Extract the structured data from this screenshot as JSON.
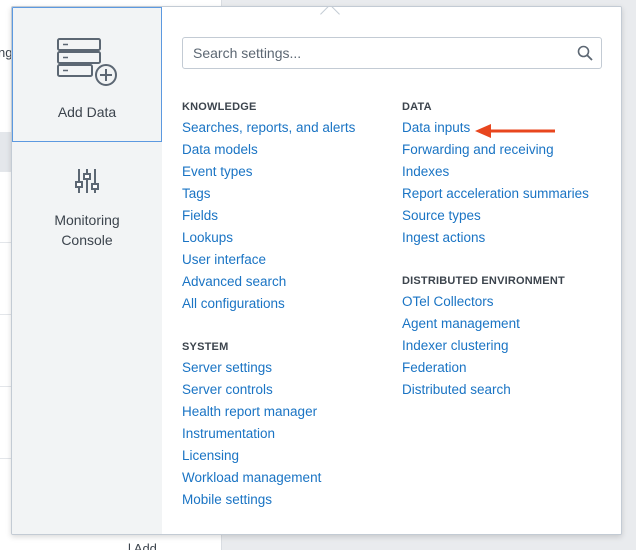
{
  "background": {
    "fragment_top": "ng",
    "fragment_bottom": "l Add"
  },
  "apps": {
    "add_data": {
      "label": "Add Data",
      "icon": "server-add-icon"
    },
    "monitoring_console": {
      "label": "Monitoring Console",
      "icon": "sliders-icon"
    }
  },
  "search": {
    "placeholder": "Search settings...",
    "icon": "search-icon"
  },
  "sections": {
    "knowledge": {
      "title": "KNOWLEDGE",
      "links": [
        "Searches, reports, and alerts",
        "Data models",
        "Event types",
        "Tags",
        "Fields",
        "Lookups",
        "User interface",
        "Advanced search",
        "All configurations"
      ]
    },
    "system": {
      "title": "SYSTEM",
      "links": [
        "Server settings",
        "Server controls",
        "Health report manager",
        "Instrumentation",
        "Licensing",
        "Workload management",
        "Mobile settings"
      ]
    },
    "data": {
      "title": "DATA",
      "links": [
        "Data inputs",
        "Forwarding and receiving",
        "Indexes",
        "Report acceleration summaries",
        "Source types",
        "Ingest actions"
      ]
    },
    "distributed": {
      "title": "DISTRIBUTED ENVIRONMENT",
      "links": [
        "OTel Collectors",
        "Agent management",
        "Indexer clustering",
        "Federation",
        "Distributed search"
      ]
    }
  },
  "colors": {
    "link": "#1a74c4",
    "annotation_arrow": "#e8461e",
    "selected_border": "#5c99e0"
  }
}
